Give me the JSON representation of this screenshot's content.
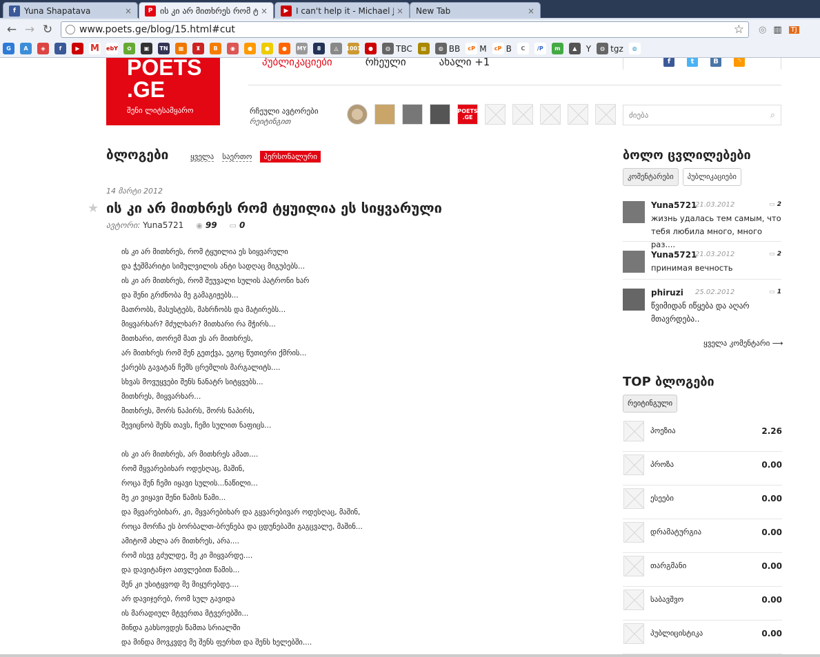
{
  "browser": {
    "tabs": [
      {
        "label": "Yuna Shapatava",
        "favicon": "facebook-icon",
        "color": "#3b5998"
      },
      {
        "label": "ის კი არ მითხრეს რომ ტყუილ",
        "favicon": "poets-icon",
        "color": "#e30613"
      },
      {
        "label": "I can't help it - Michael Jack",
        "favicon": "youtube-icon",
        "color": "#cc0000"
      },
      {
        "label": "New Tab",
        "favicon": "",
        "color": ""
      }
    ],
    "tab_close": "×",
    "url": "www.poets.ge/blog/15.html#cut",
    "bookmarks": [
      "TBC",
      "BB",
      "M",
      "B",
      "Y",
      "tgz"
    ]
  },
  "site": {
    "logo_line1": "POETS",
    "logo_line2": ".GE",
    "logo_tagline": "შენი ლიტსამყარო",
    "nav": [
      "პუბლიკაციები",
      "რჩეული",
      "ახალი +1"
    ],
    "featured_label": "რჩეული ავტორები",
    "featured_sub": "რეიტინგით",
    "search_placeholder": "ძიება",
    "avatar_logo_line1": "POETS",
    "avatar_logo_line2": ".GE"
  },
  "blogs": {
    "title": "ბლოგები",
    "filters": [
      "ყველა",
      "საერთო",
      "პერსონალური"
    ]
  },
  "post": {
    "date": "14 მარტი 2012",
    "title": "ის კი არ მითხრეს რომ ტყუილია ეს სიყვარული",
    "author_label": "ავტორი:",
    "author": "Yuna5721",
    "views": "99",
    "comments": "0",
    "stanza1": [
      "ის კი არ მითხრეს, რომ ტყუილია ეს სიყვარული",
      "და ჭეშმარიტი სიმულვილის ანტი სადღაც მიგუბებს...",
      "ის კი არ მითხრეს, რომ შეუვალი სულის პატრონი ხარ",
      "და შენი გრძნობა მე გამაგიჟებს...",
      "მათრობს, მასუსტებს, მახრჩობს და მატირებს...",
      "მიყვარხარ? მძულხარ? მითხარი რა მჭირს...",
      "მითხარი, თორემ მათ ეს არ მითხრეს,",
      "არ მითხრეს რომ შენ გეთქვა, ეგოც წუთიერი ქმრის...",
      "ქარებს გავატან ჩემს ცრემლის მარგალიტს....",
      "სხვას მოვუყვები შენს ნანატრ სიტყვებს...",
      "მითხრეს, მიყვარხარ...",
      "მითხრეს, შორს ნაპირს, შორს ნაპირს,",
      "შევიცნობ შენს თავს, ჩემი სულით ნაფიცს..."
    ],
    "stanza2": [
      "ის კი არ მითხრეს, არ მითხრეს ამათ....",
      "რომ მყვარებიხარ ოდესღაც, მაშინ,",
      "როცა შენ ჩემი იყავი სულის...ნაწილი...",
      "მე კი ვიყავი შენი წამის წამი...",
      "და მყვარებიხარ, კი, მყვარებიხარ და გყვარებივარ  ოდესღაც, მაშინ,",
      "როცა მორჩა ეს ბორბალთ-ბრუნება და ცდუნებაში გაგცვალე, მაშინ...",
      "ამიტომ ახლა არ მითხრეს, არა....",
      "რომ ისევ გძულდე, მე კი მიყვარდე....",
      "და დავიტანჯო ათვლებით წამის...",
      "შენ კი უსიტყვოდ მე მიყურებდე....",
      "არ დავიჯერებ, რომ სულ გავიდა",
      "ის მარადიულ მტვერთა მტვერებში...",
      "მინდა გახსოვდეს წამთა სრიალში",
      "და მინდა მოვკვდე მე შენს ფერხთ და შენს ხელებში...."
    ]
  },
  "sidebar": {
    "recent_title": "ბოლო ცვლილებები",
    "tabs": [
      "კომენტარები",
      "პუბლიკაციები"
    ],
    "comments": [
      {
        "user": "Yuna5721",
        "date": "21.03.2012",
        "count": "2",
        "text": "жизнь удалась тем самым, что тебя любила много, много раз...."
      },
      {
        "user": "Yuna5721",
        "date": "21.03.2012",
        "count": "2",
        "text": "принимая вечность"
      },
      {
        "user": "phiruzi",
        "date": "25.02.2012",
        "count": "1",
        "text": "წვიმიდან იწყება და აღარ მთავრდება.."
      }
    ],
    "all_comments": "ყველა კომენტარი ⟶",
    "top_title": "TOP ბლოგები",
    "rating_button": "რეიტინგული",
    "top_blogs": [
      {
        "name": "პოეზია",
        "value": "2.26"
      },
      {
        "name": "პროზა",
        "value": "0.00"
      },
      {
        "name": "ესეები",
        "value": "0.00"
      },
      {
        "name": "დრამატურგია",
        "value": "0.00"
      },
      {
        "name": "თარგმანი",
        "value": "0.00"
      },
      {
        "name": "საბავშვო",
        "value": "0.00"
      },
      {
        "name": "პუბლიცისტიკა",
        "value": "0.00"
      }
    ]
  }
}
